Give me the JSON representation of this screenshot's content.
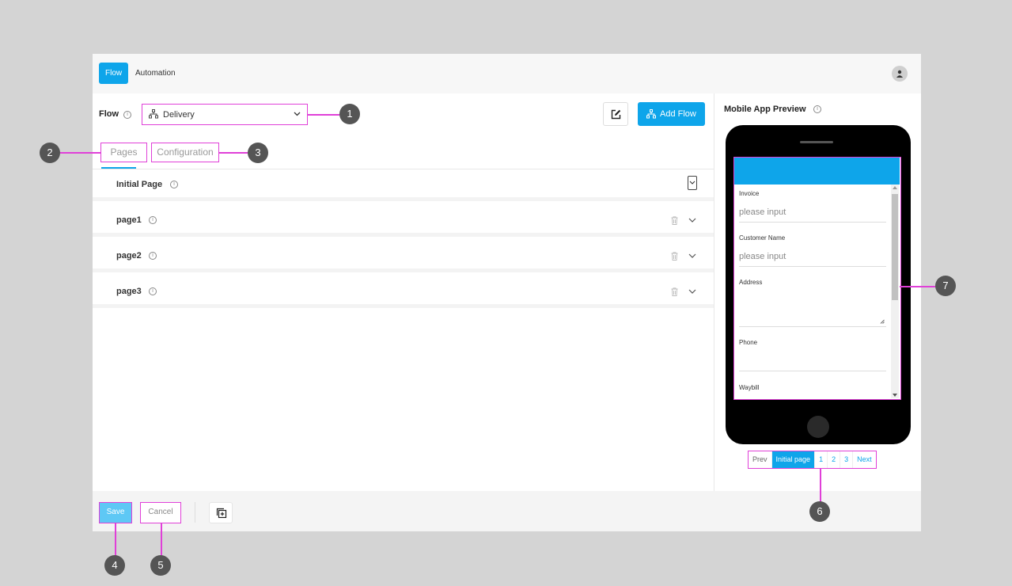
{
  "topbar": {
    "tabs": [
      "Flow",
      "Automation"
    ]
  },
  "flow": {
    "label": "Flow",
    "info": "i",
    "selected": "Delivery",
    "add_flow_label": "Add Flow"
  },
  "tabs": {
    "pages": "Pages",
    "configuration": "Configuration"
  },
  "pages": [
    {
      "name": "Initial Page"
    },
    {
      "name": "page1"
    },
    {
      "name": "page2"
    },
    {
      "name": "page3"
    }
  ],
  "preview": {
    "title": "Mobile App Preview",
    "fields": [
      {
        "label": "Invoice",
        "placeholder": "please input"
      },
      {
        "label": "Customer Name",
        "placeholder": "please input"
      },
      {
        "label": "Address",
        "placeholder": ""
      },
      {
        "label": "Phone",
        "placeholder": ""
      },
      {
        "label": "Waybill",
        "placeholder": ""
      }
    ],
    "pager": [
      "Prev",
      "Initial page",
      "1",
      "2",
      "3",
      "Next"
    ]
  },
  "footer": {
    "save": "Save",
    "cancel": "Cancel"
  },
  "callouts": [
    "1",
    "2",
    "3",
    "4",
    "5",
    "6",
    "7"
  ],
  "colors": {
    "accent": "#0ea5ea",
    "highlight": "#e040d8",
    "callout": "#555555"
  }
}
